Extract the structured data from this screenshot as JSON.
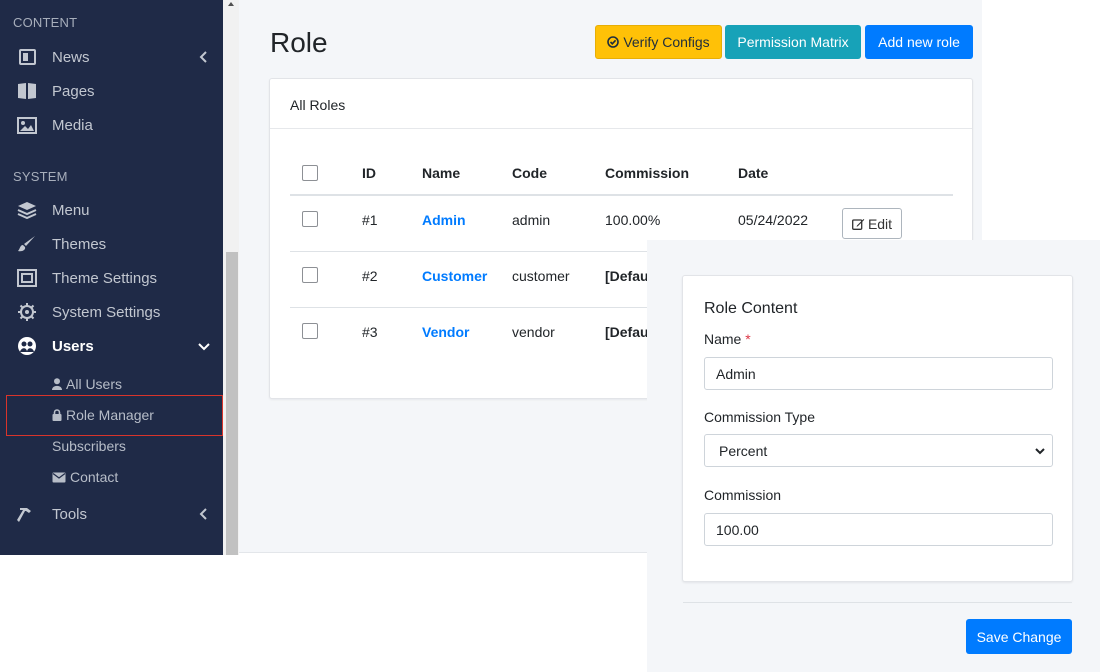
{
  "sidebar": {
    "section_content": "CONTENT",
    "section_system": "SYSTEM",
    "items": [
      {
        "label": "News",
        "icon": "newspaper-icon"
      },
      {
        "label": "Pages",
        "icon": "book-icon"
      },
      {
        "label": "Media",
        "icon": "image-icon"
      },
      {
        "label": "Menu",
        "icon": "layers-icon"
      },
      {
        "label": "Themes",
        "icon": "paintbrush-icon"
      },
      {
        "label": "Theme Settings",
        "icon": "frame-icon"
      },
      {
        "label": "System Settings",
        "icon": "gear-icon"
      },
      {
        "label": "Users",
        "icon": "users-icon"
      },
      {
        "label": "Tools",
        "icon": "hammer-icon"
      }
    ],
    "users_sub": [
      {
        "label": "All Users",
        "icon": "user-icon"
      },
      {
        "label": "Role Manager",
        "icon": "lock-icon"
      },
      {
        "label": "Subscribers",
        "icon": ""
      },
      {
        "label": "Contact",
        "icon": "envelope-icon"
      }
    ]
  },
  "header": {
    "title": "Role",
    "verify_label": "Verify Configs",
    "matrix_label": "Permission Matrix",
    "add_label": "Add new role"
  },
  "table": {
    "card_title": "All Roles",
    "columns": [
      "ID",
      "Name",
      "Code",
      "Commission",
      "Date"
    ],
    "rows": [
      {
        "id": "#1",
        "name": "Admin",
        "code": "admin",
        "commission": "100.00%",
        "date": "05/24/2022"
      },
      {
        "id": "#2",
        "name": "Customer",
        "code": "customer",
        "commission": "[Defau",
        "date": ""
      },
      {
        "id": "#3",
        "name": "Vendor",
        "code": "vendor",
        "commission": "[Defau",
        "date": ""
      }
    ],
    "edit_label": "Edit"
  },
  "form": {
    "title": "Role Content",
    "name_label": "Name",
    "required_mark": "*",
    "name_value": "Admin",
    "commission_type_label": "Commission Type",
    "commission_type_value": "Percent",
    "commission_label": "Commission",
    "commission_value": "100.00",
    "save_label": "Save Change"
  },
  "colors": {
    "sidebar_bg": "#1f2a47",
    "warning": "#ffc107",
    "info": "#17a2b8",
    "primary": "#007bff",
    "link": "#007bff",
    "highlight": "#d9342b"
  }
}
